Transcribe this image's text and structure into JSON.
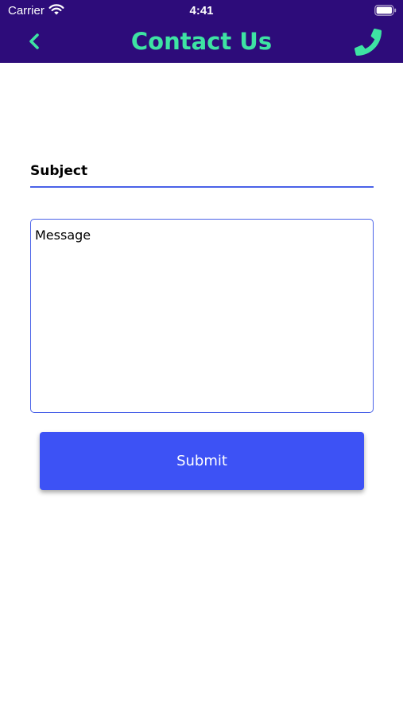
{
  "status_bar": {
    "carrier": "Carrier",
    "time": "4:41"
  },
  "header": {
    "title": "Contact Us",
    "background_color": "#2d0c7a",
    "accent_color": "#3ee3a3",
    "left_icon": "chevron-left-icon",
    "right_icon": "phone-icon"
  },
  "form": {
    "subject_placeholder": "Subject",
    "message_placeholder": "Message",
    "submit_label": "Submit",
    "field_border_color": "#4a62e8",
    "submit_color": "#3d52f5"
  }
}
